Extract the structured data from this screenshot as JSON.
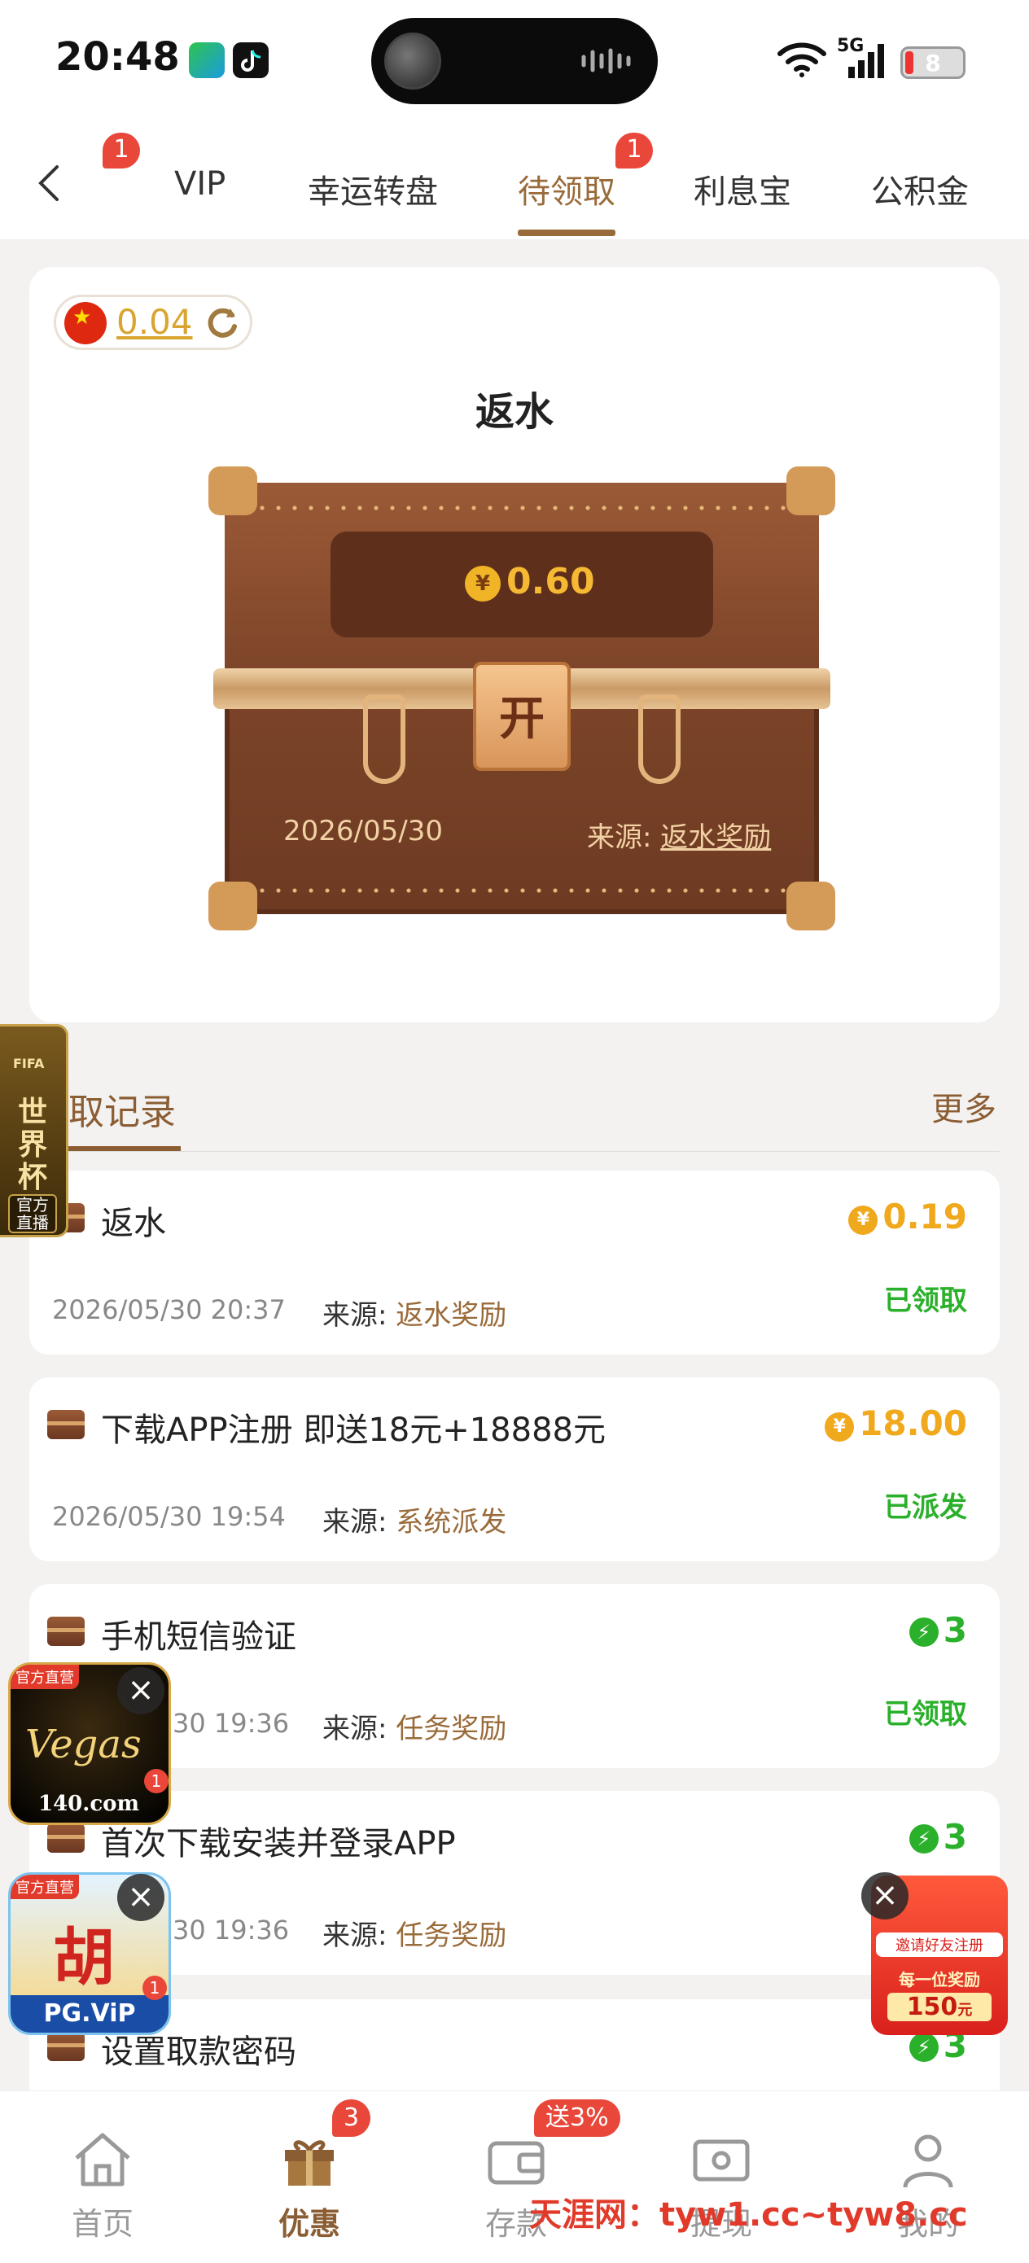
{
  "status_bar": {
    "time": "20:48",
    "network": "5G",
    "battery": "8"
  },
  "top_tabs": {
    "back_icon": "chevron-left-icon",
    "first_badge": "1",
    "items": [
      {
        "label": "VIP"
      },
      {
        "label": "幸运转盘"
      },
      {
        "label": "待领取",
        "active": true,
        "badge": "1"
      },
      {
        "label": "利息宝"
      },
      {
        "label": "公积金"
      }
    ]
  },
  "reward_card": {
    "balance": "0.04",
    "title": "返水",
    "amount": "0.60",
    "coin_symbol": "¥",
    "open_label": "开",
    "date": "2026/05/30",
    "source_label": "来源:",
    "source_value": "返水奖励"
  },
  "records": {
    "title": "取记录",
    "more_label": "更多",
    "source_label": "来源:",
    "items": [
      {
        "name": "返水",
        "amount": "0.19",
        "amount_type": "coin",
        "date": "2026/05/30 20:37",
        "source": "返水奖励",
        "status": "已领取"
      },
      {
        "name": "下载APP注册 即送18元+18888元",
        "amount": "18.00",
        "amount_type": "coin",
        "date": "2026/05/30 19:54",
        "source": "系统派发",
        "status": "已派发"
      },
      {
        "name": "手机短信验证",
        "amount": "3",
        "amount_type": "bolt",
        "date": "30 19:36",
        "source": "任务奖励",
        "status": "已领取"
      },
      {
        "name": "首次下载安装并登录APP",
        "amount": "3",
        "amount_type": "bolt",
        "date": "30 19:36",
        "source": "任务奖励",
        "status": ""
      },
      {
        "name": "设置取款密码",
        "amount": "3",
        "amount_type": "bolt",
        "date": "",
        "source": "",
        "status": ""
      }
    ]
  },
  "floating": {
    "worldcup": {
      "title": "世界杯",
      "sub": "官方直播",
      "small": "FIFA"
    },
    "ad_vegas": {
      "tag": "官方直营",
      "brand": "Vegas",
      "domain": "140.com",
      "badge": "1"
    },
    "ad_pg": {
      "tag": "官方直营",
      "brand": "胡",
      "domain": "PG.ViP",
      "badge": "1"
    },
    "ad_invite": {
      "line1": "邀请好友注册",
      "line2": "每一位奖励",
      "amount": "150",
      "unit": "元"
    }
  },
  "bottom_nav": {
    "items": [
      {
        "label": "首页",
        "icon": "home-icon"
      },
      {
        "label": "优惠",
        "icon": "gift-icon",
        "badge": "3",
        "active": true
      },
      {
        "label": "存款",
        "icon": "wallet-icon",
        "badge": "送3%"
      },
      {
        "label": "提现",
        "icon": "ticket-icon"
      },
      {
        "label": "我的",
        "icon": "user-icon"
      }
    ]
  },
  "watermark": {
    "site": "天涯网",
    "sep": "：",
    "domains": "tyw1.cc~tyw8.cc"
  },
  "colors": {
    "brand": "#9a6b3a",
    "badge": "#e8473a",
    "success": "#2bb02b",
    "coin": "#f0a81c"
  }
}
